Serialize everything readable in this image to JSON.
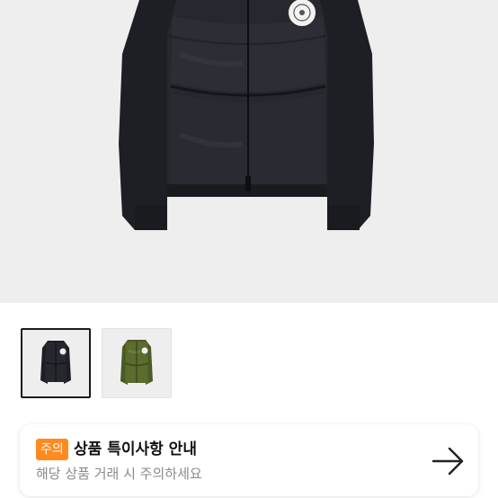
{
  "product": {
    "main_image": "black-down-padded-knit-jacket",
    "thumbnails": [
      {
        "image": "black-jacket-thumbnail",
        "selected": true
      },
      {
        "image": "khaki-green-jacket-thumbnail",
        "selected": false
      }
    ]
  },
  "notice": {
    "badge": "주의",
    "title": "상품 특이사항 안내",
    "subtitle": "해당 상품 거래 시 주의하세요",
    "icon": "arrow-right-icon"
  },
  "colors": {
    "accent": "#ff8a1f",
    "jacket_black": "#24252b",
    "jacket_green": "#5c6b2e",
    "background": "#eeeeee"
  }
}
